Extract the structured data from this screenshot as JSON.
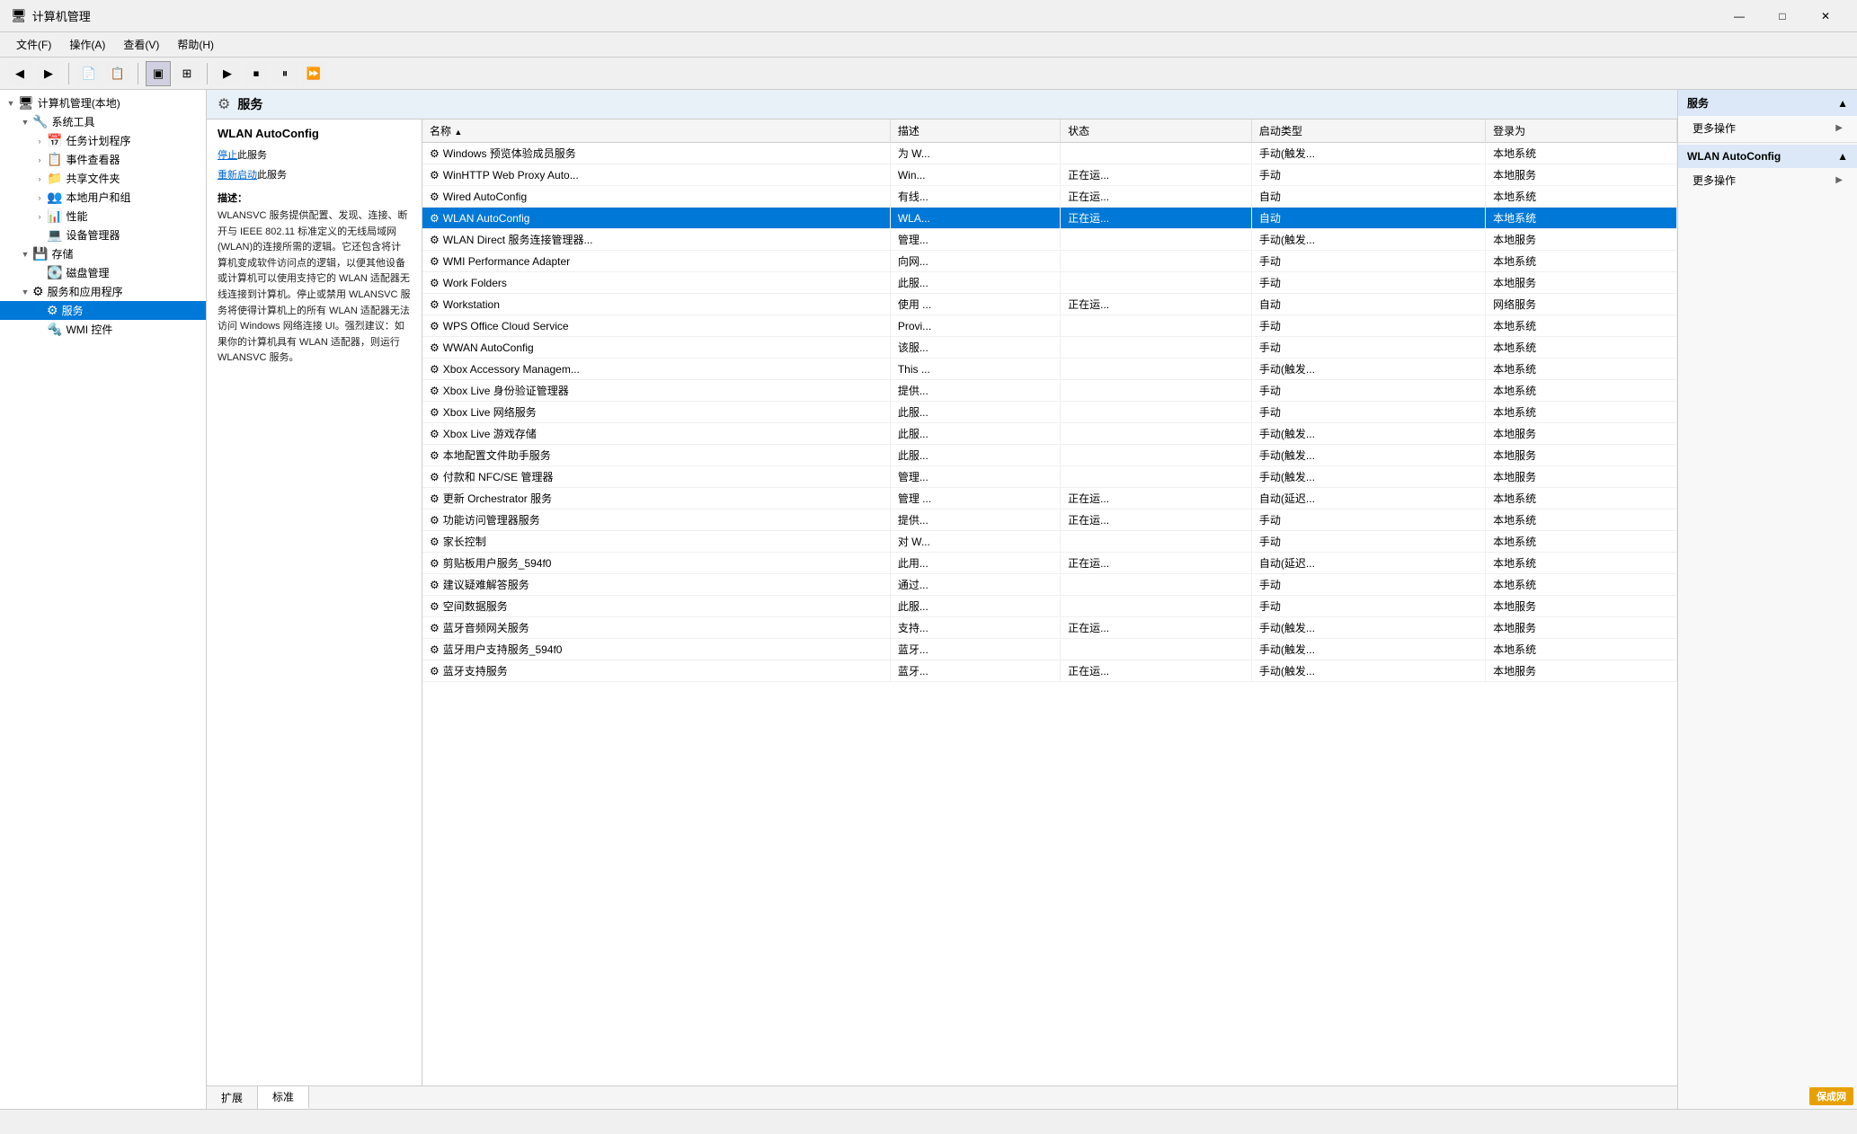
{
  "window": {
    "title": "计算机管理",
    "icon": "🖥"
  },
  "titlebar": {
    "minimize": "—",
    "maximize": "□",
    "close": "✕"
  },
  "menu": {
    "items": [
      "文件(F)",
      "操作(A)",
      "查看(V)",
      "帮助(H)"
    ]
  },
  "left_panel": {
    "tree": [
      {
        "level": 0,
        "label": "计算机管理(本地)",
        "icon": "🖥",
        "toggle": "▼",
        "selected": false
      },
      {
        "level": 1,
        "label": "系统工具",
        "icon": "🔧",
        "toggle": "▼",
        "selected": false
      },
      {
        "level": 2,
        "label": "任务计划程序",
        "icon": "📅",
        "toggle": ">",
        "selected": false
      },
      {
        "level": 2,
        "label": "事件查看器",
        "icon": "📋",
        "toggle": ">",
        "selected": false
      },
      {
        "level": 2,
        "label": "共享文件夹",
        "icon": "📁",
        "toggle": ">",
        "selected": false
      },
      {
        "level": 2,
        "label": "本地用户和组",
        "icon": "👥",
        "toggle": ">",
        "selected": false
      },
      {
        "level": 2,
        "label": "性能",
        "icon": "📊",
        "toggle": ">",
        "selected": false
      },
      {
        "level": 2,
        "label": "设备管理器",
        "icon": "💻",
        "toggle": "",
        "selected": false
      },
      {
        "level": 1,
        "label": "存储",
        "icon": "💾",
        "toggle": "▼",
        "selected": false
      },
      {
        "level": 2,
        "label": "磁盘管理",
        "icon": "💽",
        "toggle": "",
        "selected": false
      },
      {
        "level": 1,
        "label": "服务和应用程序",
        "icon": "⚙",
        "toggle": "▼",
        "selected": false
      },
      {
        "level": 2,
        "label": "服务",
        "icon": "⚙",
        "toggle": "",
        "selected": true
      },
      {
        "level": 2,
        "label": "WMI 控件",
        "icon": "🔩",
        "toggle": "",
        "selected": false
      }
    ]
  },
  "service_header": {
    "title": "服务"
  },
  "selected_service": {
    "name": "WLAN AutoConfig",
    "action_stop": "停止",
    "action_restart": "重新启动",
    "desc_label": "描述：",
    "description": "WLANSVC 服务提供配置、发现、连接、断开与 IEEE 802.11 标准定义的无线局域网(WLAN)的连接所需的逻辑。它还包含将计算机变成软件访问点的逻辑，以便其他设备或计算机可以使用支持它的 WLAN 适配器无线连接到计算机。停止或禁用 WLANSVC 服务将使得计算机上的所有 WLAN 适配器无法访问 Windows 网络连接 UI。强烈建议：如果你的计算机具有 WLAN 适配器，则运行 WLANSVC 服务。"
  },
  "table": {
    "columns": [
      "名称",
      "描述",
      "状态",
      "启动类型",
      "登录为"
    ],
    "rows": [
      {
        "name": "Windows 预览体验成员服务",
        "desc": "为 W...",
        "status": "",
        "startup": "手动(触发...",
        "login": "本地系统",
        "selected": false
      },
      {
        "name": "WinHTTP Web Proxy Auto...",
        "desc": "Win...",
        "status": "正在运...",
        "startup": "手动",
        "login": "本地服务",
        "selected": false
      },
      {
        "name": "Wired AutoConfig",
        "desc": "有线...",
        "status": "正在运...",
        "startup": "自动",
        "login": "本地系统",
        "selected": false
      },
      {
        "name": "WLAN AutoConfig",
        "desc": "WLA...",
        "status": "正在运...",
        "startup": "自动",
        "login": "本地系统",
        "selected": true
      },
      {
        "name": "WLAN Direct 服务连接管理器...",
        "desc": "管理...",
        "status": "",
        "startup": "手动(触发...",
        "login": "本地服务",
        "selected": false
      },
      {
        "name": "WMI Performance Adapter",
        "desc": "向网...",
        "status": "",
        "startup": "手动",
        "login": "本地系统",
        "selected": false
      },
      {
        "name": "Work Folders",
        "desc": "此服...",
        "status": "",
        "startup": "手动",
        "login": "本地服务",
        "selected": false
      },
      {
        "name": "Workstation",
        "desc": "使用 ...",
        "status": "正在运...",
        "startup": "自动",
        "login": "网络服务",
        "selected": false
      },
      {
        "name": "WPS Office Cloud Service",
        "desc": "Provi...",
        "status": "",
        "startup": "手动",
        "login": "本地系统",
        "selected": false
      },
      {
        "name": "WWAN AutoConfig",
        "desc": "该服...",
        "status": "",
        "startup": "手动",
        "login": "本地系统",
        "selected": false
      },
      {
        "name": "Xbox Accessory Managem...",
        "desc": "This ...",
        "status": "",
        "startup": "手动(触发...",
        "login": "本地系统",
        "selected": false
      },
      {
        "name": "Xbox Live 身份验证管理器",
        "desc": "提供...",
        "status": "",
        "startup": "手动",
        "login": "本地系统",
        "selected": false
      },
      {
        "name": "Xbox Live 网络服务",
        "desc": "此服...",
        "status": "",
        "startup": "手动",
        "login": "本地系统",
        "selected": false
      },
      {
        "name": "Xbox Live 游戏存储",
        "desc": "此服...",
        "status": "",
        "startup": "手动(触发...",
        "login": "本地服务",
        "selected": false
      },
      {
        "name": "本地配置文件助手服务",
        "desc": "此服...",
        "status": "",
        "startup": "手动(触发...",
        "login": "本地服务",
        "selected": false
      },
      {
        "name": "付款和 NFC/SE 管理器",
        "desc": "管理...",
        "status": "",
        "startup": "手动(触发...",
        "login": "本地服务",
        "selected": false
      },
      {
        "name": "更新 Orchestrator 服务",
        "desc": "管理 ...",
        "status": "正在运...",
        "startup": "自动(延迟...",
        "login": "本地系统",
        "selected": false
      },
      {
        "name": "功能访问管理器服务",
        "desc": "提供...",
        "status": "正在运...",
        "startup": "手动",
        "login": "本地系统",
        "selected": false
      },
      {
        "name": "家长控制",
        "desc": "对 W...",
        "status": "",
        "startup": "手动",
        "login": "本地系统",
        "selected": false
      },
      {
        "name": "剪贴板用户服务_594f0",
        "desc": "此用...",
        "status": "正在运...",
        "startup": "自动(延迟...",
        "login": "本地系统",
        "selected": false
      },
      {
        "name": "建议疑难解答服务",
        "desc": "通过...",
        "status": "",
        "startup": "手动",
        "login": "本地系统",
        "selected": false
      },
      {
        "name": "空间数据服务",
        "desc": "此服...",
        "status": "",
        "startup": "手动",
        "login": "本地服务",
        "selected": false
      },
      {
        "name": "蓝牙音频网关服务",
        "desc": "支持...",
        "status": "正在运...",
        "startup": "手动(触发...",
        "login": "本地服务",
        "selected": false
      },
      {
        "name": "蓝牙用户支持服务_594f0",
        "desc": "蓝牙...",
        "status": "",
        "startup": "手动(触发...",
        "login": "本地系统",
        "selected": false
      },
      {
        "name": "蓝牙支持服务",
        "desc": "蓝牙...",
        "status": "正在运...",
        "startup": "手动(触发...",
        "login": "本地服务",
        "selected": false
      }
    ]
  },
  "tabs": [
    "扩展",
    "标准"
  ],
  "right_panel": {
    "sections": [
      {
        "title": "服务",
        "items": [
          "更多操作"
        ]
      },
      {
        "title": "WLAN AutoConfig",
        "items": [
          "更多操作"
        ]
      }
    ]
  },
  "toolbar": {
    "buttons": [
      "◀",
      "▶",
      "⬛",
      "↑",
      "📄",
      "📋",
      "🖥",
      "🔧",
      "▶",
      "⏹",
      "⏸",
      "⏩"
    ]
  },
  "bottom_logo": "保成网"
}
